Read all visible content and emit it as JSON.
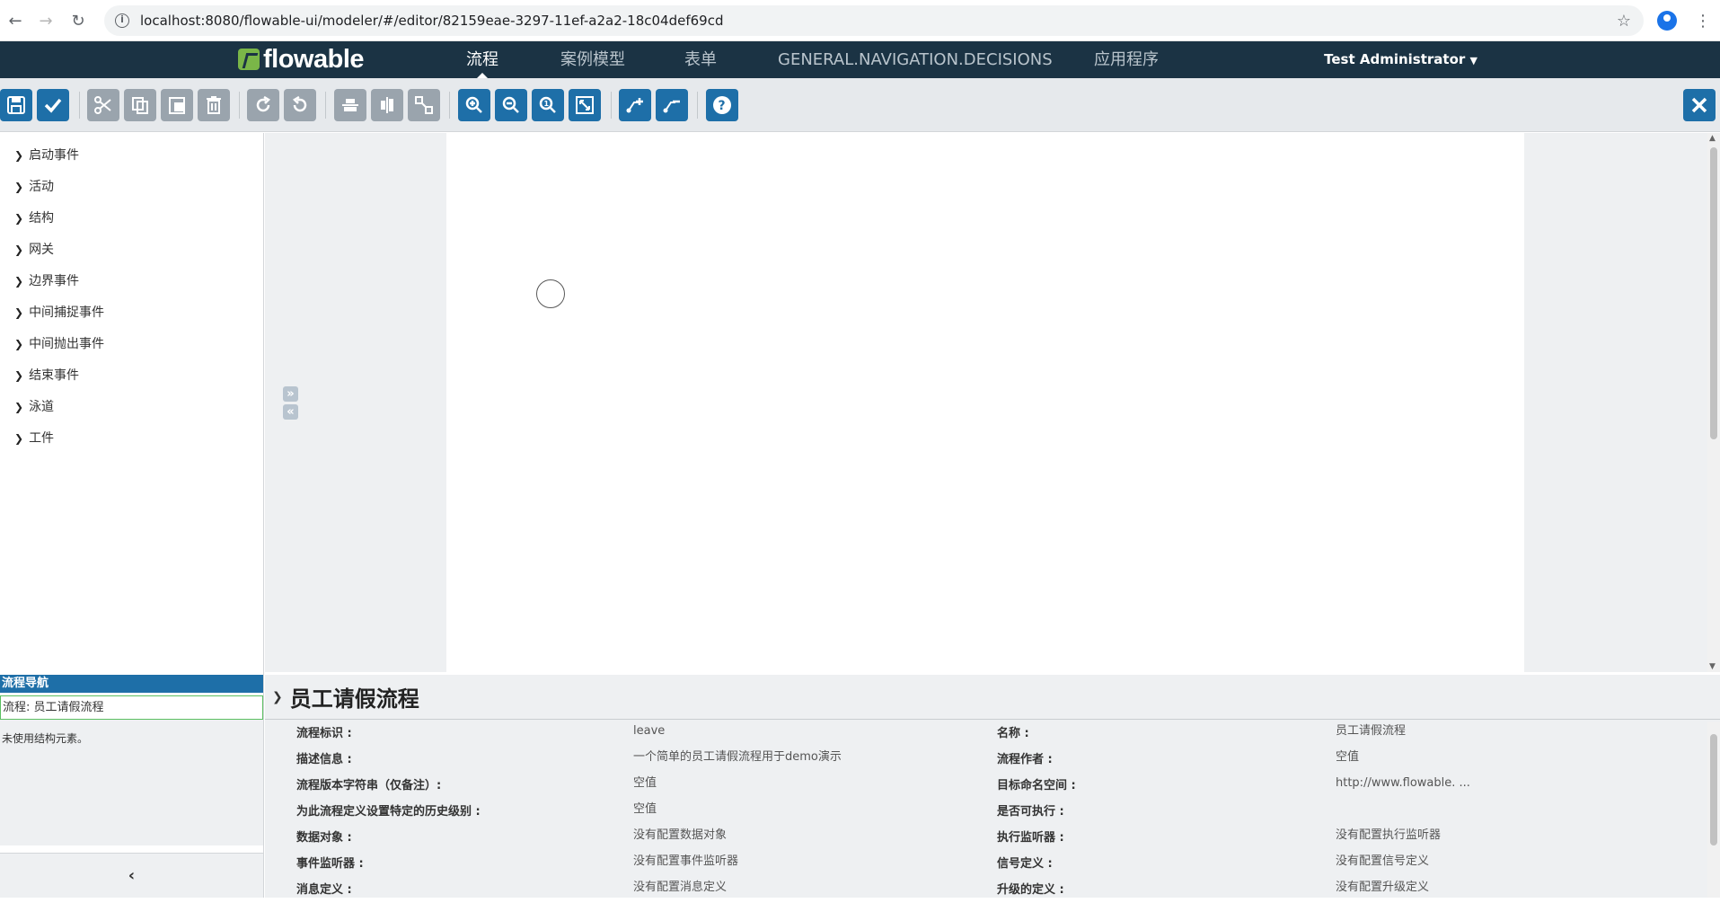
{
  "browser": {
    "url": "localhost:8080/flowable-ui/modeler/#/editor/82159eae-3297-11ef-a2a2-18c04def69cd"
  },
  "nav": {
    "logo": "flowable",
    "items": [
      "流程",
      "案例模型",
      "表单",
      "GENERAL.NAVIGATION.DECISIONS",
      "应用程序"
    ],
    "active": "流程",
    "user": "Test Administrator"
  },
  "palette": {
    "groups": [
      "启动事件",
      "活动",
      "结构",
      "网关",
      "边界事件",
      "中间捕捉事件",
      "中间抛出事件",
      "结束事件",
      "泳道",
      "工件"
    ]
  },
  "navigator": {
    "title": "流程导航",
    "item": "流程: 员工请假流程",
    "note": "未使用结构元素。"
  },
  "properties": {
    "title": "员工请假流程",
    "rows": [
      {
        "l_label": "流程标识 :",
        "l_value": "leave",
        "r_label": "名称 :",
        "r_value": "员工请假流程"
      },
      {
        "l_label": "描述信息 :",
        "l_value": "一个简单的员工请假流程用于demo演示",
        "r_label": "流程作者 :",
        "r_value": "空值"
      },
      {
        "l_label": "流程版本字符串（仅备注）:",
        "l_value": "空值",
        "r_label": "目标命名空间 :",
        "r_value": "http://www.flowable. ..."
      },
      {
        "l_label": "为此流程定义设置特定的历史级别 :",
        "l_value": "空值",
        "r_label": "是否可执行 :",
        "r_value": ""
      },
      {
        "l_label": "数据对象 :",
        "l_value": "没有配置数据对象",
        "r_label": "执行监听器 :",
        "r_value": "没有配置执行监听器"
      },
      {
        "l_label": "事件监听器 :",
        "l_value": "没有配置事件监听器",
        "r_label": "信号定义 :",
        "r_value": "没有配置信号定义"
      },
      {
        "l_label": "消息定义 :",
        "l_value": "没有配置消息定义",
        "r_label": "升级的定义 :",
        "r_value": "没有配置升级定义"
      }
    ]
  },
  "colors": {
    "navbar": "#1b3344",
    "toolbar_button": "#1e6fa8",
    "logo_green": "#7ab648"
  }
}
